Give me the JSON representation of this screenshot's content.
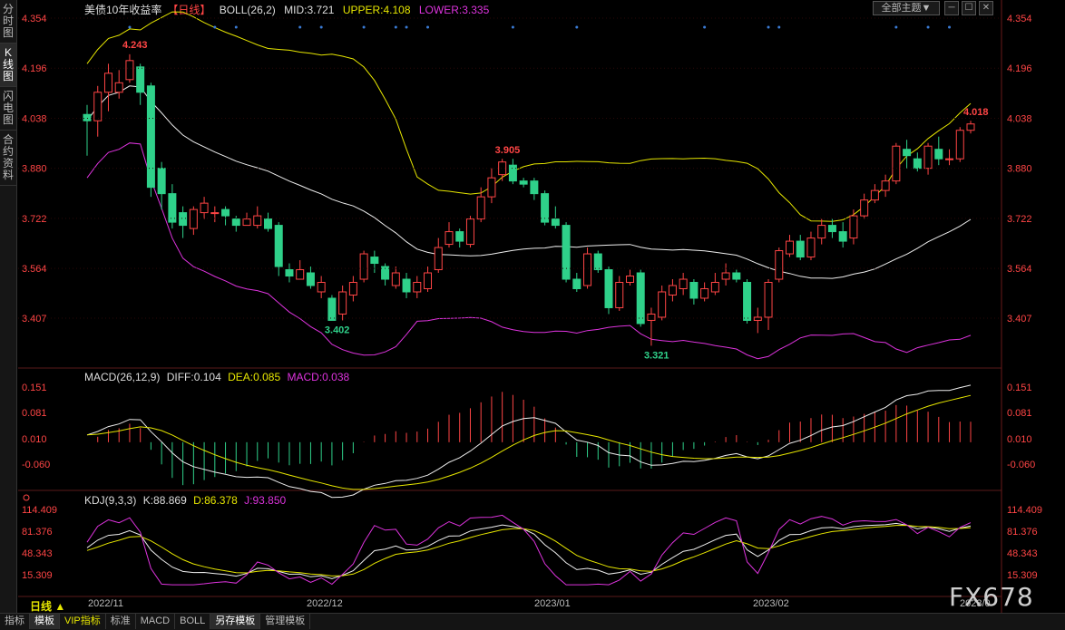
{
  "sidebar": {
    "tabs": [
      {
        "label": "分时图",
        "active": false
      },
      {
        "label": "K线图",
        "active": true
      },
      {
        "label": "闪电图",
        "active": false
      },
      {
        "label": "合约资料",
        "active": false
      }
    ]
  },
  "header": {
    "title": "美债10年收益率",
    "period": "【日线】",
    "boll": "BOLL(26,2)",
    "mid": "MID:3.721",
    "upper": "UPPER:4.108",
    "lower": "LOWER:3.335",
    "theme_select": "全部主题▼"
  },
  "main_axis": {
    "ticks": [
      "4.354",
      "4.196",
      "4.038",
      "3.880",
      "3.722",
      "3.564",
      "3.407"
    ]
  },
  "annotations": {
    "high1": "4.243",
    "low1": "3.402",
    "high2": "3.905",
    "low2": "3.321",
    "last": "4.018"
  },
  "macd": {
    "label": "MACD(26,12,9)",
    "diff": "DIFF:0.104",
    "dea": "DEA:0.085",
    "macd": "MACD:0.038",
    "ticks": [
      "0.151",
      "0.081",
      "0.010",
      "-0.060"
    ]
  },
  "kdj": {
    "label": "KDJ(9,3,3)",
    "k": "K:88.869",
    "d": "D:86.378",
    "j": "J:93.850",
    "ticks": [
      "114.409",
      "81.376",
      "48.343",
      "15.309"
    ]
  },
  "dates": [
    "2022/11",
    "2022/12",
    "2023/01",
    "2023/02",
    "2023/0"
  ],
  "period_tag": "日线 ▲",
  "watermark": "FX678",
  "bottom_tabs": [
    "指标",
    "模板",
    "VIP指标",
    "标准",
    "MACD",
    "BOLL",
    "另存模板",
    "管理模板"
  ],
  "colors": {
    "up": "#ff4545",
    "down": "#2fd18a",
    "upper": "#e6e600",
    "lower": "#dd33dd",
    "mid": "#eeeeee"
  },
  "chart_data": {
    "type": "candlestick",
    "title": "美债10年收益率",
    "x_labels": [
      "2022/11",
      "2022/12",
      "2023/01",
      "2023/02",
      "2023/0"
    ],
    "candles": [
      [
        4.05,
        4.03,
        4.08,
        3.92
      ],
      [
        4.03,
        4.12,
        4.14,
        3.98
      ],
      [
        4.12,
        4.18,
        4.21,
        4.06
      ],
      [
        4.12,
        4.15,
        4.19,
        4.1
      ],
      [
        4.16,
        4.22,
        4.24,
        4.15
      ],
      [
        4.2,
        4.12,
        4.21,
        4.08
      ],
      [
        4.14,
        3.82,
        4.15,
        3.79
      ],
      [
        3.88,
        3.8,
        3.9,
        3.75
      ],
      [
        3.8,
        3.71,
        3.83,
        3.69
      ],
      [
        3.74,
        3.7,
        3.76,
        3.66
      ],
      [
        3.69,
        3.75,
        3.76,
        3.67
      ],
      [
        3.74,
        3.77,
        3.79,
        3.72
      ],
      [
        3.74,
        3.74,
        3.76,
        3.71
      ],
      [
        3.75,
        3.73,
        3.76,
        3.7
      ],
      [
        3.72,
        3.7,
        3.73,
        3.68
      ],
      [
        3.7,
        3.72,
        3.74,
        3.7
      ],
      [
        3.7,
        3.73,
        3.76,
        3.69
      ],
      [
        3.72,
        3.69,
        3.74,
        3.68
      ],
      [
        3.7,
        3.57,
        3.71,
        3.54
      ],
      [
        3.56,
        3.54,
        3.58,
        3.52
      ],
      [
        3.53,
        3.56,
        3.59,
        3.53
      ],
      [
        3.55,
        3.51,
        3.57,
        3.5
      ],
      [
        3.49,
        3.52,
        3.54,
        3.47
      ],
      [
        3.47,
        3.4,
        3.48,
        3.4
      ],
      [
        3.42,
        3.49,
        3.51,
        3.4
      ],
      [
        3.48,
        3.52,
        3.54,
        3.46
      ],
      [
        3.53,
        3.61,
        3.62,
        3.52
      ],
      [
        3.6,
        3.58,
        3.62,
        3.55
      ],
      [
        3.57,
        3.53,
        3.58,
        3.51
      ],
      [
        3.51,
        3.55,
        3.57,
        3.5
      ],
      [
        3.53,
        3.49,
        3.55,
        3.47
      ],
      [
        3.49,
        3.52,
        3.54,
        3.47
      ],
      [
        3.5,
        3.55,
        3.57,
        3.49
      ],
      [
        3.56,
        3.63,
        3.66,
        3.55
      ],
      [
        3.64,
        3.68,
        3.71,
        3.63
      ],
      [
        3.68,
        3.65,
        3.69,
        3.63
      ],
      [
        3.64,
        3.72,
        3.73,
        3.63
      ],
      [
        3.72,
        3.79,
        3.82,
        3.71
      ],
      [
        3.79,
        3.85,
        3.88,
        3.77
      ],
      [
        3.86,
        3.9,
        3.91,
        3.84
      ],
      [
        3.89,
        3.84,
        3.91,
        3.83
      ],
      [
        3.84,
        3.83,
        3.85,
        3.82
      ],
      [
        3.84,
        3.8,
        3.85,
        3.78
      ],
      [
        3.8,
        3.71,
        3.81,
        3.7
      ],
      [
        3.72,
        3.7,
        3.76,
        3.69
      ],
      [
        3.7,
        3.53,
        3.71,
        3.52
      ],
      [
        3.53,
        3.5,
        3.55,
        3.49
      ],
      [
        3.51,
        3.61,
        3.63,
        3.5
      ],
      [
        3.61,
        3.56,
        3.62,
        3.55
      ],
      [
        3.56,
        3.44,
        3.57,
        3.42
      ],
      [
        3.44,
        3.52,
        3.54,
        3.43
      ],
      [
        3.52,
        3.54,
        3.56,
        3.51
      ],
      [
        3.55,
        3.39,
        3.56,
        3.38
      ],
      [
        3.4,
        3.42,
        3.44,
        3.32
      ],
      [
        3.41,
        3.49,
        3.51,
        3.4
      ],
      [
        3.48,
        3.51,
        3.53,
        3.46
      ],
      [
        3.5,
        3.53,
        3.55,
        3.48
      ],
      [
        3.52,
        3.47,
        3.53,
        3.45
      ],
      [
        3.47,
        3.5,
        3.52,
        3.46
      ],
      [
        3.49,
        3.52,
        3.55,
        3.48
      ],
      [
        3.53,
        3.55,
        3.58,
        3.51
      ],
      [
        3.55,
        3.53,
        3.56,
        3.52
      ],
      [
        3.52,
        3.4,
        3.53,
        3.39
      ],
      [
        3.4,
        3.41,
        3.44,
        3.36
      ],
      [
        3.41,
        3.52,
        3.53,
        3.37
      ],
      [
        3.53,
        3.62,
        3.63,
        3.52
      ],
      [
        3.61,
        3.65,
        3.67,
        3.6
      ],
      [
        3.65,
        3.6,
        3.67,
        3.59
      ],
      [
        3.6,
        3.66,
        3.68,
        3.59
      ],
      [
        3.66,
        3.7,
        3.72,
        3.64
      ],
      [
        3.7,
        3.68,
        3.72,
        3.66
      ],
      [
        3.68,
        3.65,
        3.71,
        3.63
      ],
      [
        3.66,
        3.73,
        3.75,
        3.64
      ],
      [
        3.73,
        3.78,
        3.8,
        3.72
      ],
      [
        3.78,
        3.81,
        3.83,
        3.77
      ],
      [
        3.81,
        3.84,
        3.86,
        3.79
      ],
      [
        3.84,
        3.95,
        3.96,
        3.83
      ],
      [
        3.94,
        3.92,
        3.97,
        3.88
      ],
      [
        3.91,
        3.88,
        3.93,
        3.87
      ],
      [
        3.88,
        3.95,
        3.96,
        3.86
      ],
      [
        3.94,
        3.91,
        3.98,
        3.89
      ],
      [
        3.91,
        3.91,
        3.94,
        3.89
      ],
      [
        3.91,
        4.0,
        4.01,
        3.9
      ],
      [
        4.0,
        4.02,
        4.03,
        3.99
      ]
    ]
  }
}
